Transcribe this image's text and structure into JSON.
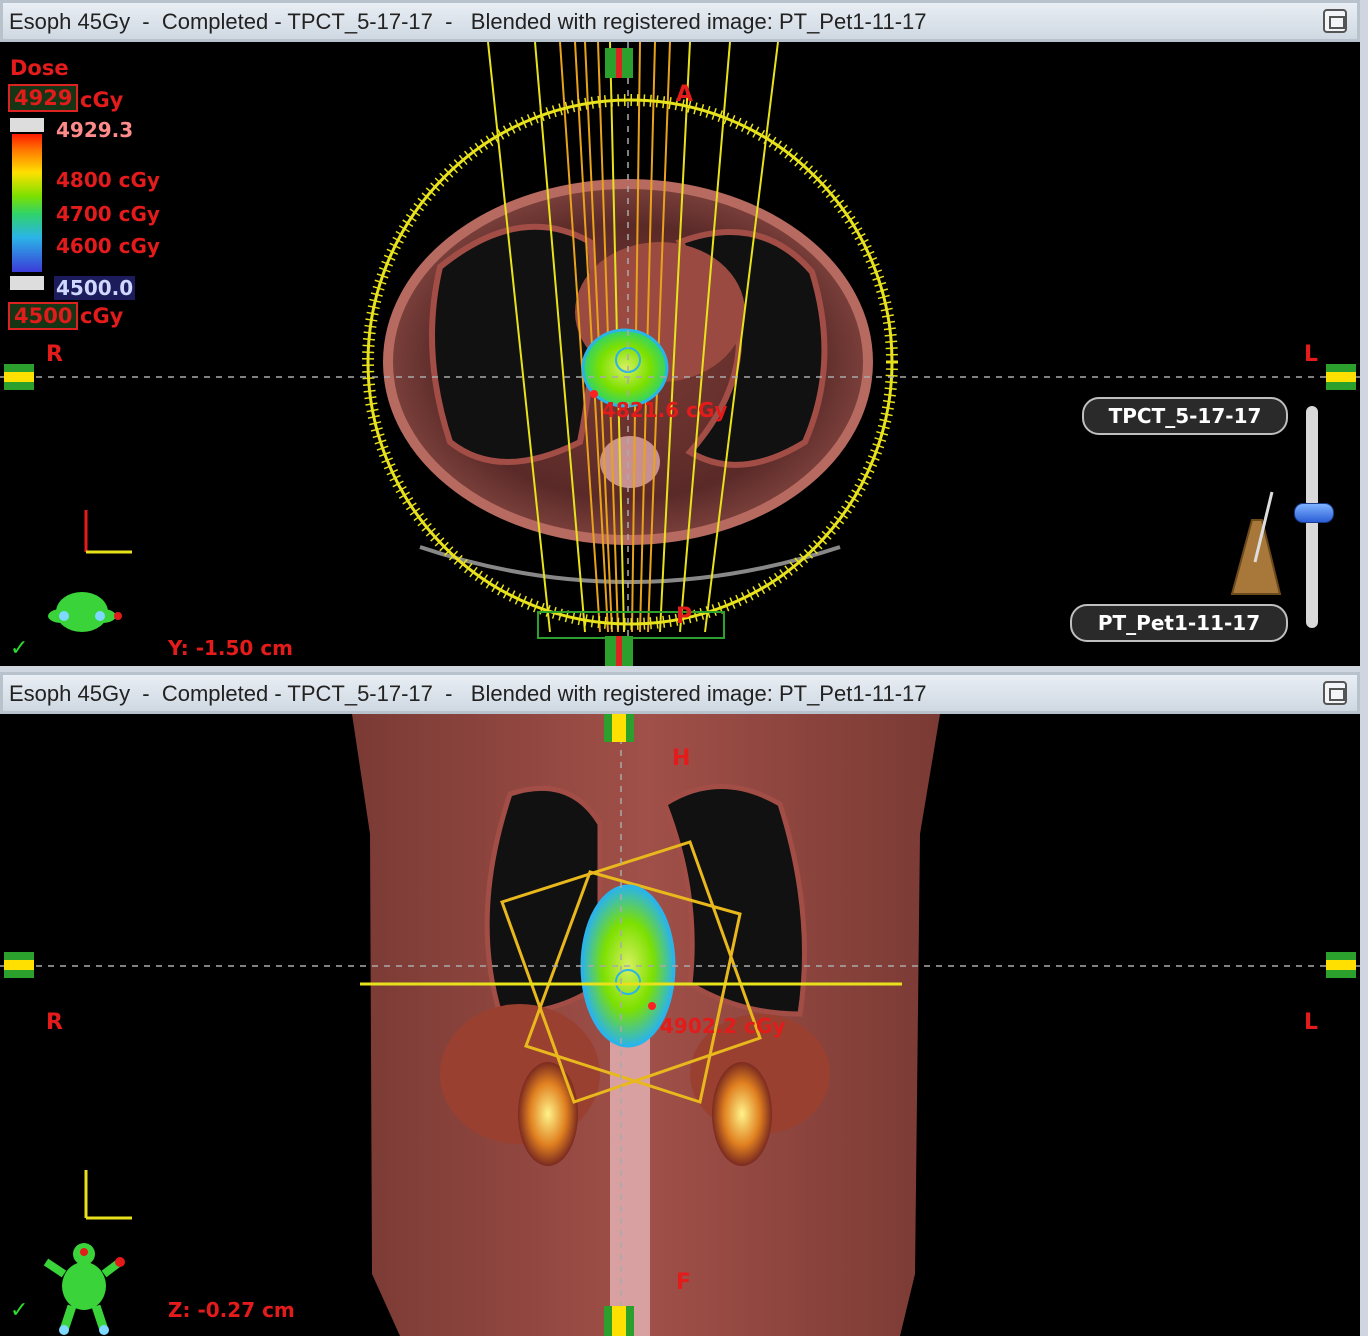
{
  "top_view": {
    "title": "Esoph 45Gy  -  Completed - TPCT_5-17-17  -   Blended with registered image: PT_Pet1-11-17",
    "dose_label": "Dose",
    "dose_max_value": "4929",
    "dose_min_value": "4500",
    "dose_unit": "cGy",
    "legend_max": "4929.3",
    "legend_min": "4500.0",
    "legend_ticks": [
      "4800 cGy",
      "4700 cGy",
      "4600 cGy"
    ],
    "orient_top": "A",
    "orient_bottom": "P",
    "orient_left": "R",
    "orient_right": "L",
    "point_dose": "4821.6 cGy",
    "coordinate_readout": "Y: -1.50 cm",
    "image_set_primary": "TPCT_5-17-17",
    "image_set_secondary": "PT_Pet1-11-17",
    "blend_level": 0.48,
    "icons": [
      "maximize-icon",
      "metronome-icon",
      "patient-orientation-icon",
      "check-icon"
    ]
  },
  "bottom_view": {
    "title": "Esoph 45Gy  -  Completed - TPCT_5-17-17  -   Blended with registered image: PT_Pet1-11-17",
    "orient_top": "H",
    "orient_bottom": "F",
    "orient_left": "R",
    "orient_right": "L",
    "point_dose": "4902.2 cGy",
    "coordinate_readout": "Z: -0.27 cm",
    "icons": [
      "maximize-icon",
      "patient-orientation-icon",
      "check-icon"
    ]
  },
  "colors": {
    "label_red": "#e31b1b",
    "beam_yellow": "#e8e21c",
    "beam_orange": "#e8a21c",
    "tumor_green": "#7ce000",
    "title_bar": "#dbe2ea"
  }
}
